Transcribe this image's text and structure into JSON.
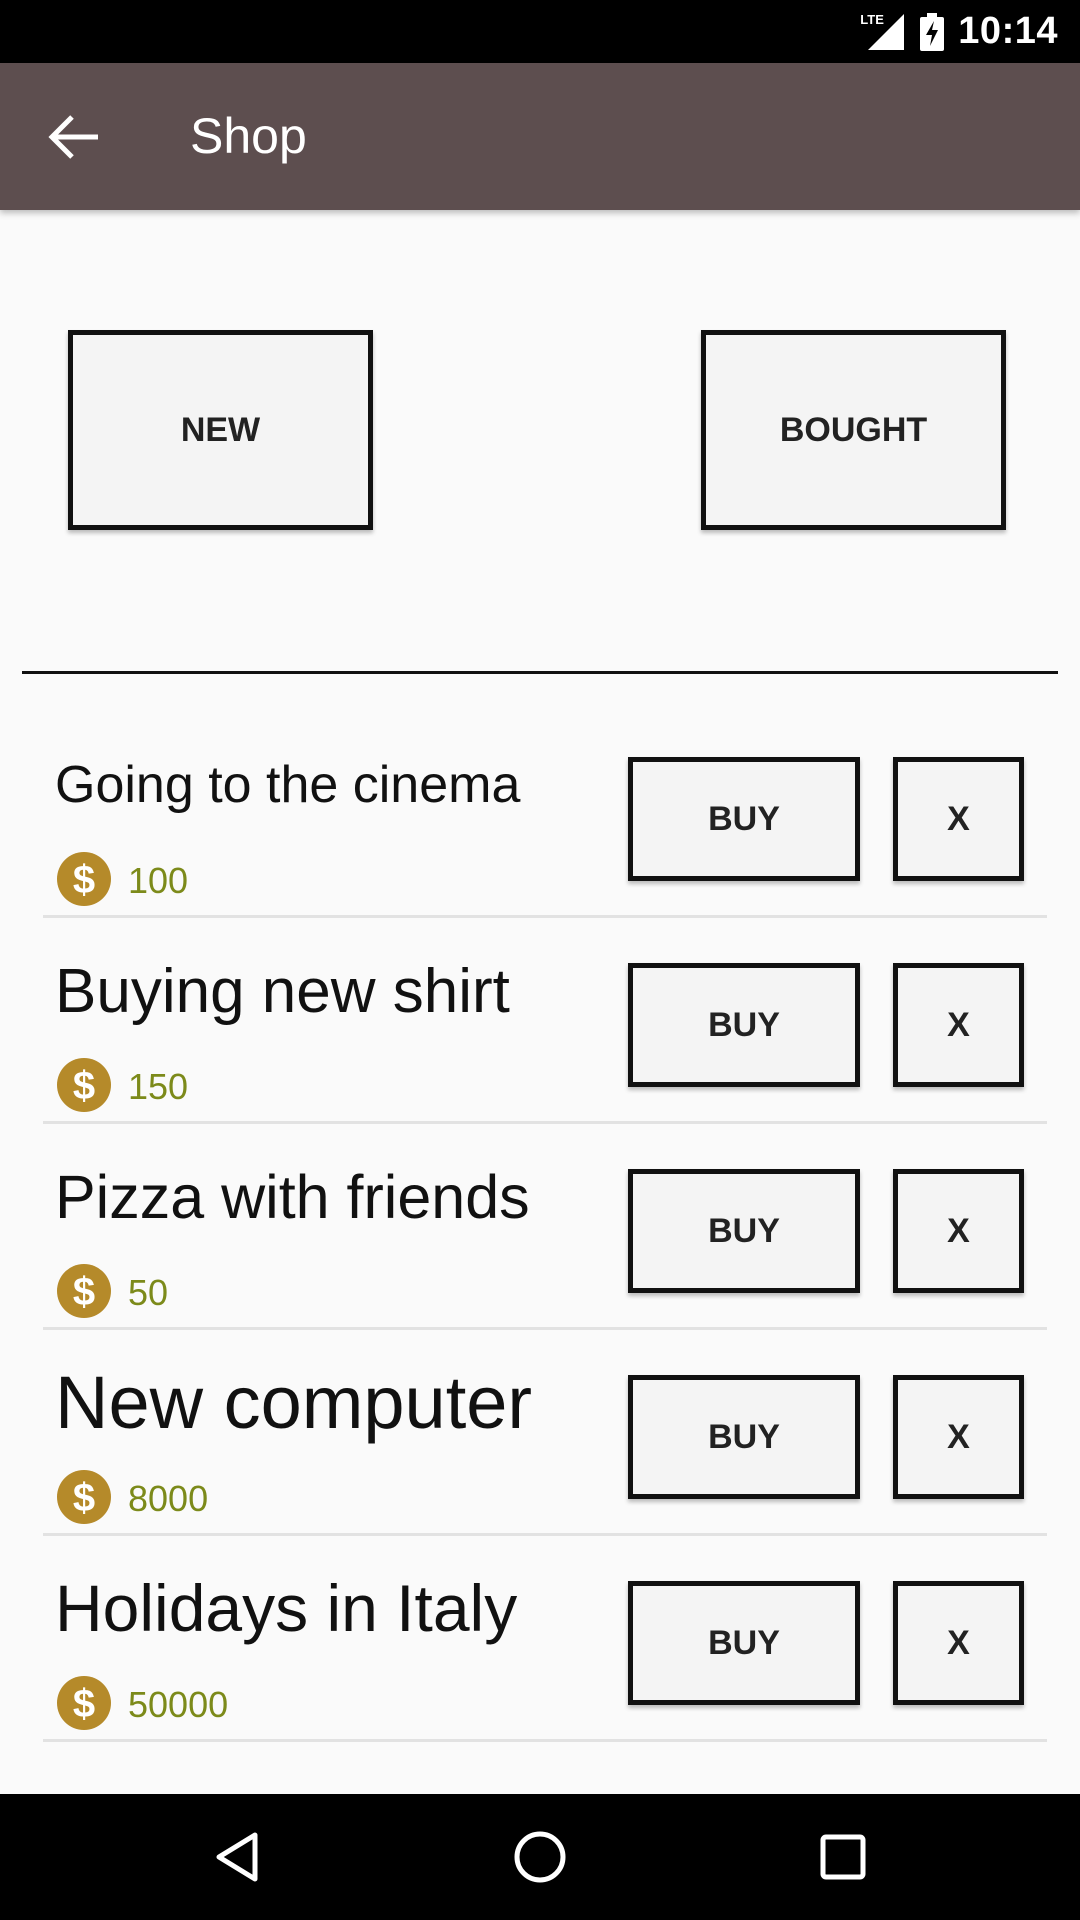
{
  "status_bar": {
    "network": "LTE",
    "time": "10:14"
  },
  "app_bar": {
    "title": "Shop",
    "back_icon": "arrow-back-icon"
  },
  "tabs": {
    "new_label": "NEW",
    "bought_label": "BOUGHT"
  },
  "items": [
    {
      "title": "Going to the cinema",
      "price": "100",
      "buy_label": "BUY",
      "remove_label": "X"
    },
    {
      "title": "Buying new shirt",
      "price": "150",
      "buy_label": "BUY",
      "remove_label": "X"
    },
    {
      "title": "Pizza with friends",
      "price": "50",
      "buy_label": "BUY",
      "remove_label": "X"
    },
    {
      "title": "New computer",
      "price": "8000",
      "buy_label": "BUY",
      "remove_label": "X"
    },
    {
      "title": "Holidays in Italy",
      "price": "50000",
      "buy_label": "BUY",
      "remove_label": "X"
    }
  ],
  "nav_bar": {
    "back": "nav-back-icon",
    "home": "nav-home-icon",
    "recents": "nav-recents-icon"
  },
  "colors": {
    "app_bar": "#5d4e4f",
    "coin": "#b58a2a",
    "price": "#7c8a1a"
  }
}
